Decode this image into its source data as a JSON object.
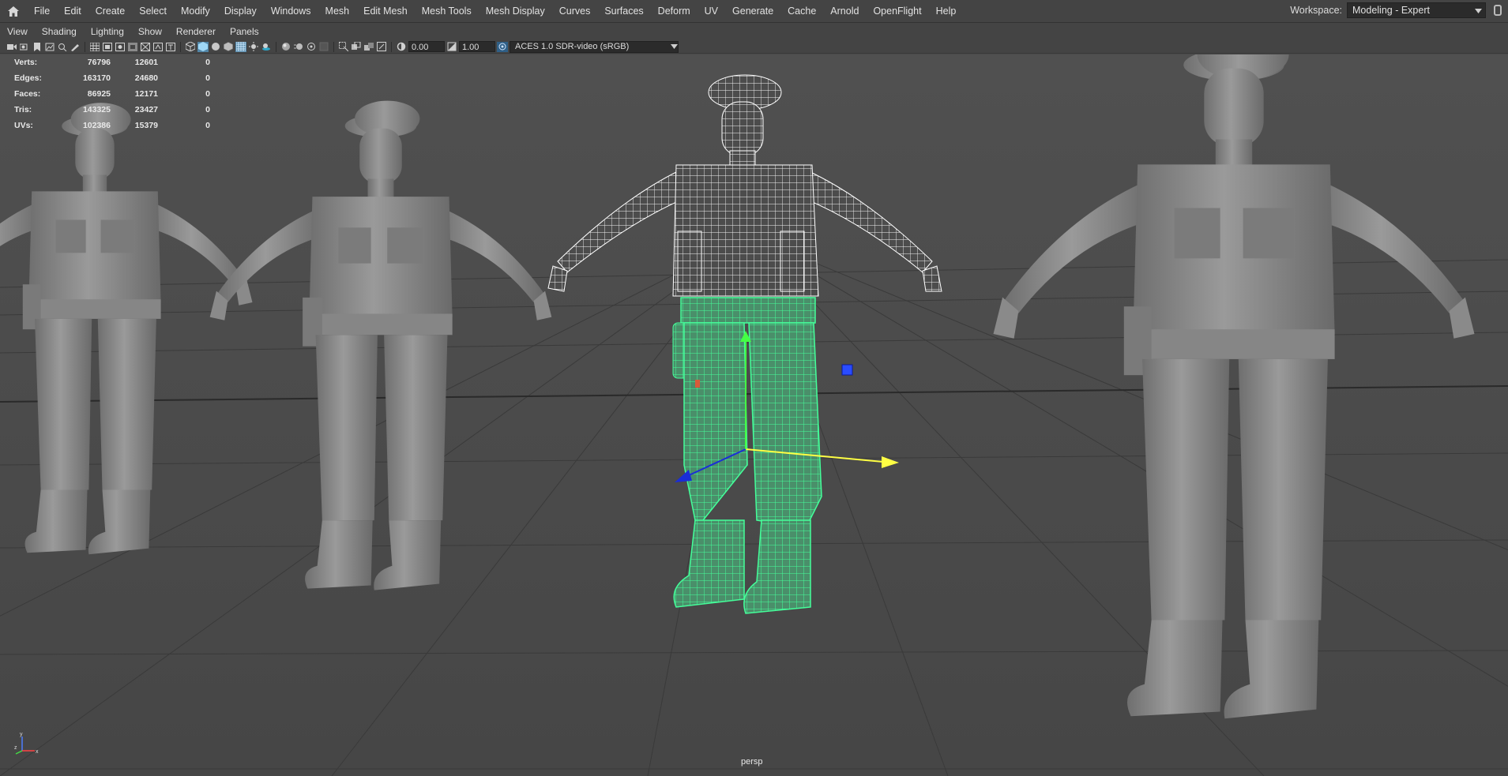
{
  "menus": [
    "File",
    "Edit",
    "Create",
    "Select",
    "Modify",
    "Display",
    "Windows",
    "Mesh",
    "Edit Mesh",
    "Mesh Tools",
    "Mesh Display",
    "Curves",
    "Surfaces",
    "Deform",
    "UV",
    "Generate",
    "Cache",
    "Arnold",
    "OpenFlight",
    "Help"
  ],
  "workspace": {
    "label": "Workspace:",
    "value": "Modeling - Expert"
  },
  "panel_menus": [
    "View",
    "Shading",
    "Lighting",
    "Show",
    "Renderer",
    "Panels"
  ],
  "toolbar": {
    "exposure": "0.00",
    "gamma": "1.00",
    "color_space": "ACES 1.0 SDR-video (sRGB)"
  },
  "hud": {
    "rows": [
      {
        "label": "Verts:",
        "a": "76796",
        "b": "12601",
        "c": "0"
      },
      {
        "label": "Edges:",
        "a": "163170",
        "b": "24680",
        "c": "0"
      },
      {
        "label": "Faces:",
        "a": "86925",
        "b": "12171",
        "c": "0"
      },
      {
        "label": "Tris:",
        "a": "143325",
        "b": "23427",
        "c": "0"
      },
      {
        "label": "UVs:",
        "a": "102386",
        "b": "15379",
        "c": "0"
      }
    ]
  },
  "camera": "persp",
  "colors": {
    "selection": "#38e08a",
    "wire": "#ffffff",
    "viewport_bg": "#4a4a4a",
    "grid": "#3a3a3a",
    "axis_x": "#ffff44",
    "axis_z": "#1a2dd8"
  }
}
